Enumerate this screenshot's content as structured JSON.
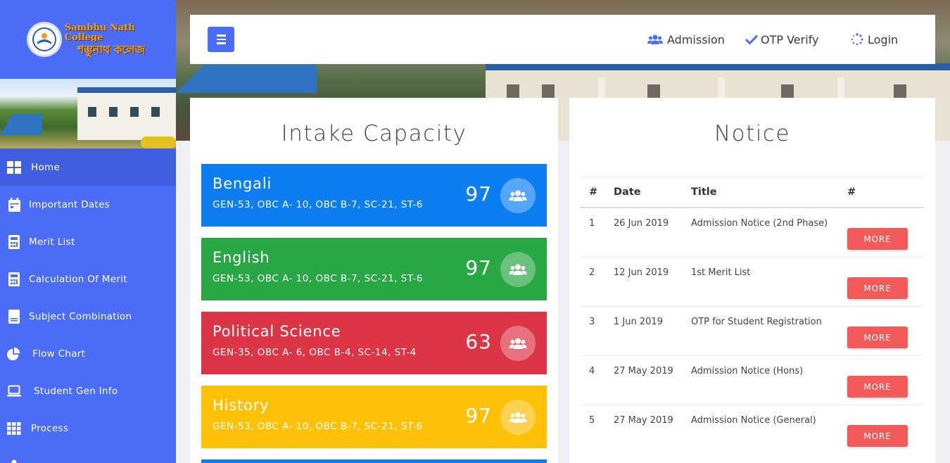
{
  "logo": {
    "name_en": "Sambhu Nath College",
    "name_bn": "শম্ভুনাথ কলেজ"
  },
  "sidebar": {
    "items": [
      {
        "label": "Home",
        "icon": "grid-icon",
        "active": true
      },
      {
        "label": "Important Dates",
        "icon": "calendar-icon",
        "active": false
      },
      {
        "label": "Merit List",
        "icon": "calculator-icon",
        "active": false
      },
      {
        "label": "Calculation Of Merit",
        "icon": "calculator-icon",
        "active": false
      },
      {
        "label": "Subject Combination",
        "icon": "document-icon",
        "active": false
      },
      {
        "label": "Flow Chart",
        "icon": "pie-chart-icon",
        "active": false
      },
      {
        "label": "Student Gen Info",
        "icon": "laptop-icon",
        "active": false
      },
      {
        "label": "Process",
        "icon": "apps-grid-icon",
        "active": false
      }
    ]
  },
  "topbar": {
    "admission": "Admission",
    "otp_verify": "OTP Verify",
    "login": "Login"
  },
  "intake": {
    "title": "Intake Capacity",
    "subjects": [
      {
        "name": "Bengali",
        "details": "GEN-53, OBC A- 10, OBC B-7, SC-21, ST-6",
        "count": "97",
        "color": "#0d7ef2"
      },
      {
        "name": "English",
        "details": "GEN-53, OBC A- 10, OBC B-7, SC-21, ST-6",
        "count": "97",
        "color": "#28a745"
      },
      {
        "name": "Political Science",
        "details": "GEN-35, OBC A- 6, OBC B-4, SC-14, ST-4",
        "count": "63",
        "color": "#dc3545"
      },
      {
        "name": "History",
        "details": "GEN-53, OBC A- 10, OBC B-7, SC-21, ST-6",
        "count": "97",
        "color": "#ffc107"
      }
    ]
  },
  "notice": {
    "title": "Notice",
    "headers": [
      "#",
      "Date",
      "Title",
      "#"
    ],
    "more_label": "MORE",
    "rows": [
      {
        "no": "1",
        "date": "26 Jun 2019",
        "title": "Admission Notice (2nd Phase)"
      },
      {
        "no": "2",
        "date": "12 Jun 2019",
        "title": "1st Merit List"
      },
      {
        "no": "3",
        "date": "1 Jun 2019",
        "title": "OTP for Student Registration"
      },
      {
        "no": "4",
        "date": "27 May 2019",
        "title": "Admission Notice (Hons)"
      },
      {
        "no": "5",
        "date": "27 May 2019",
        "title": "Admission Notice (General)"
      }
    ]
  }
}
